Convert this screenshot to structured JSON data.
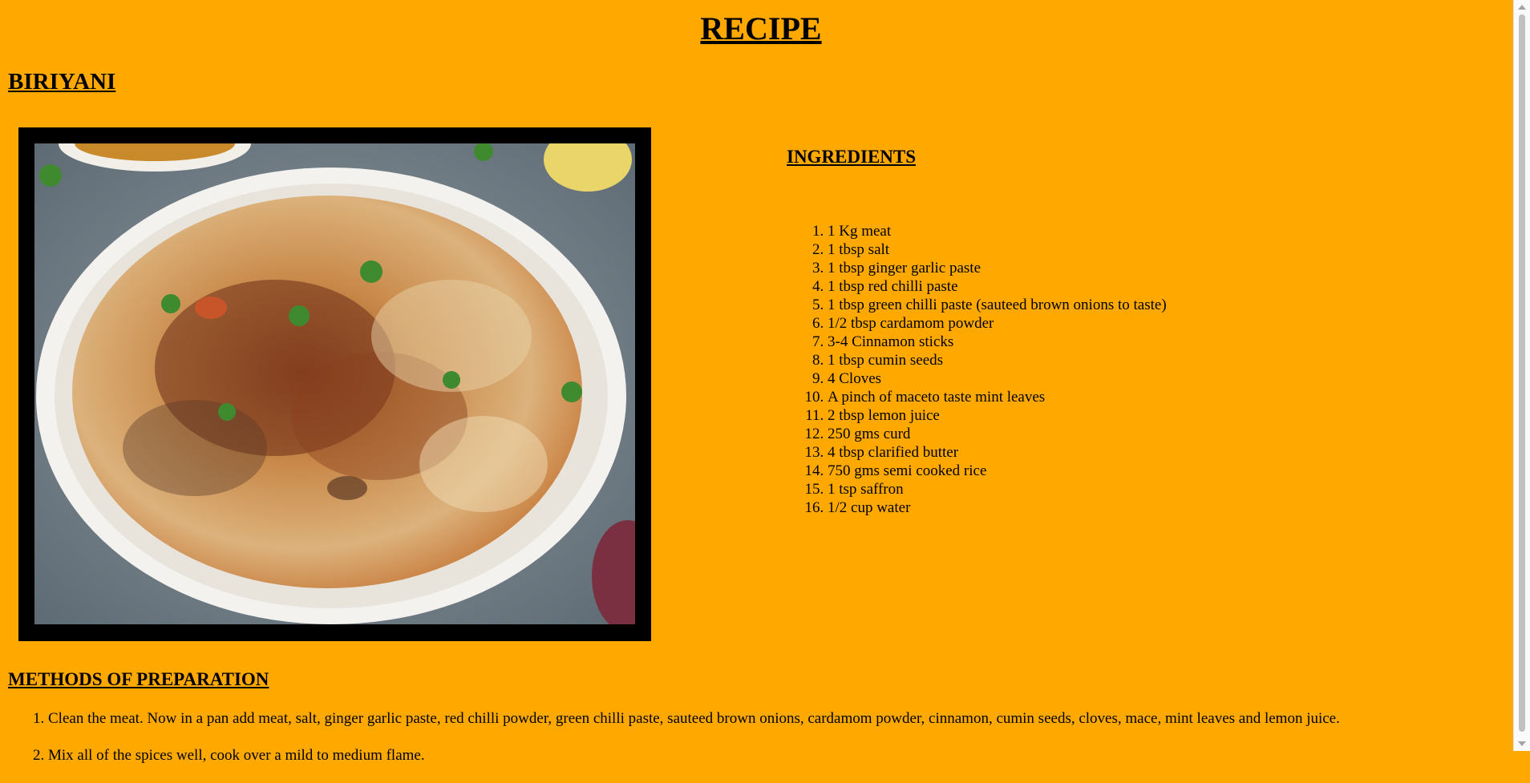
{
  "header": {
    "title": "RECIPE"
  },
  "dish": {
    "name": "BIRIYANI",
    "photo": {
      "icon": "biriyani-plate-photo",
      "description": "plate of chicken biriyani"
    }
  },
  "ingredients": {
    "title": "INGREDIENTS",
    "items": [
      "1 Kg meat",
      "1 tbsp salt",
      "1 tbsp ginger garlic paste",
      "1 tbsp red chilli paste",
      "1 tbsp green chilli paste (sauteed brown onions to taste)",
      "1/2 tbsp cardamom powder",
      "3-4 Cinnamon sticks",
      "1 tbsp cumin seeds",
      "4 Cloves",
      "A pinch of maceto taste mint leaves",
      "2 tbsp lemon juice",
      "250 gms curd",
      "4 tbsp clarified butter",
      "750 gms semi cooked rice",
      "1 tsp saffron",
      "1/2 cup water"
    ]
  },
  "methods": {
    "title": "METHODS OF PREPARATION",
    "steps": [
      "Clean the meat. Now in a pan add meat, salt, ginger garlic paste, red chilli powder, green chilli paste, sauteed brown onions, cardamom powder, cinnamon, cumin seeds, cloves, mace, mint leaves and lemon juice.",
      "Mix all of the spices well, cook over a mild to medium flame."
    ]
  },
  "colors": {
    "background": "#FFA900",
    "frame": "#000000"
  }
}
